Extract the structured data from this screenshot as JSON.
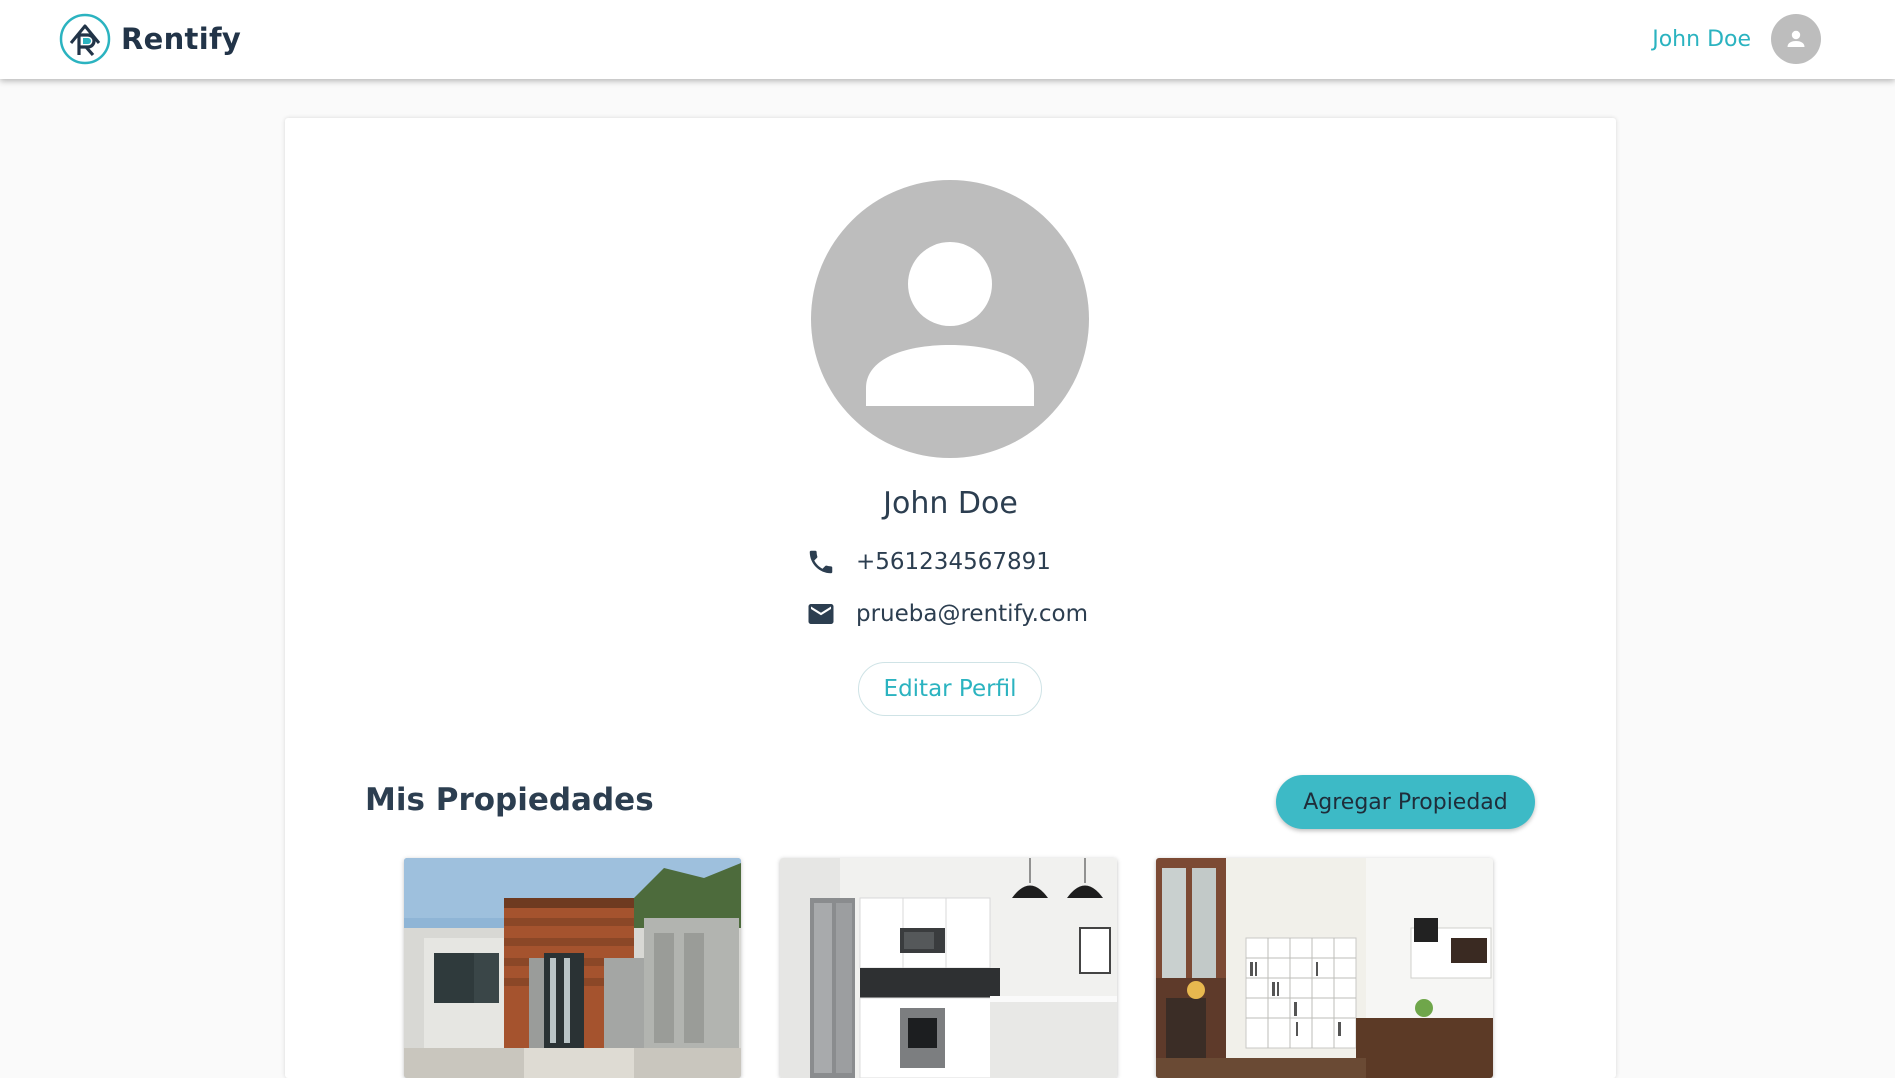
{
  "header": {
    "brand_name": "Rentify",
    "user_name": "John Doe"
  },
  "profile": {
    "name": "John Doe",
    "phone": "+561234567891",
    "email": "prueba@rentify.com",
    "edit_label": "Editar Perfil"
  },
  "properties": {
    "title": "Mis Propiedades",
    "add_label": "Agregar Propiedad"
  },
  "colors": {
    "accent": "#2bb3c0",
    "button": "#3dbac6",
    "text": "#2c3e50",
    "avatar": "#bdbdbd"
  },
  "icons": {
    "logo": "rentify-logo-icon",
    "user": "user-avatar-icon",
    "phone": "phone-icon",
    "email": "email-icon"
  }
}
